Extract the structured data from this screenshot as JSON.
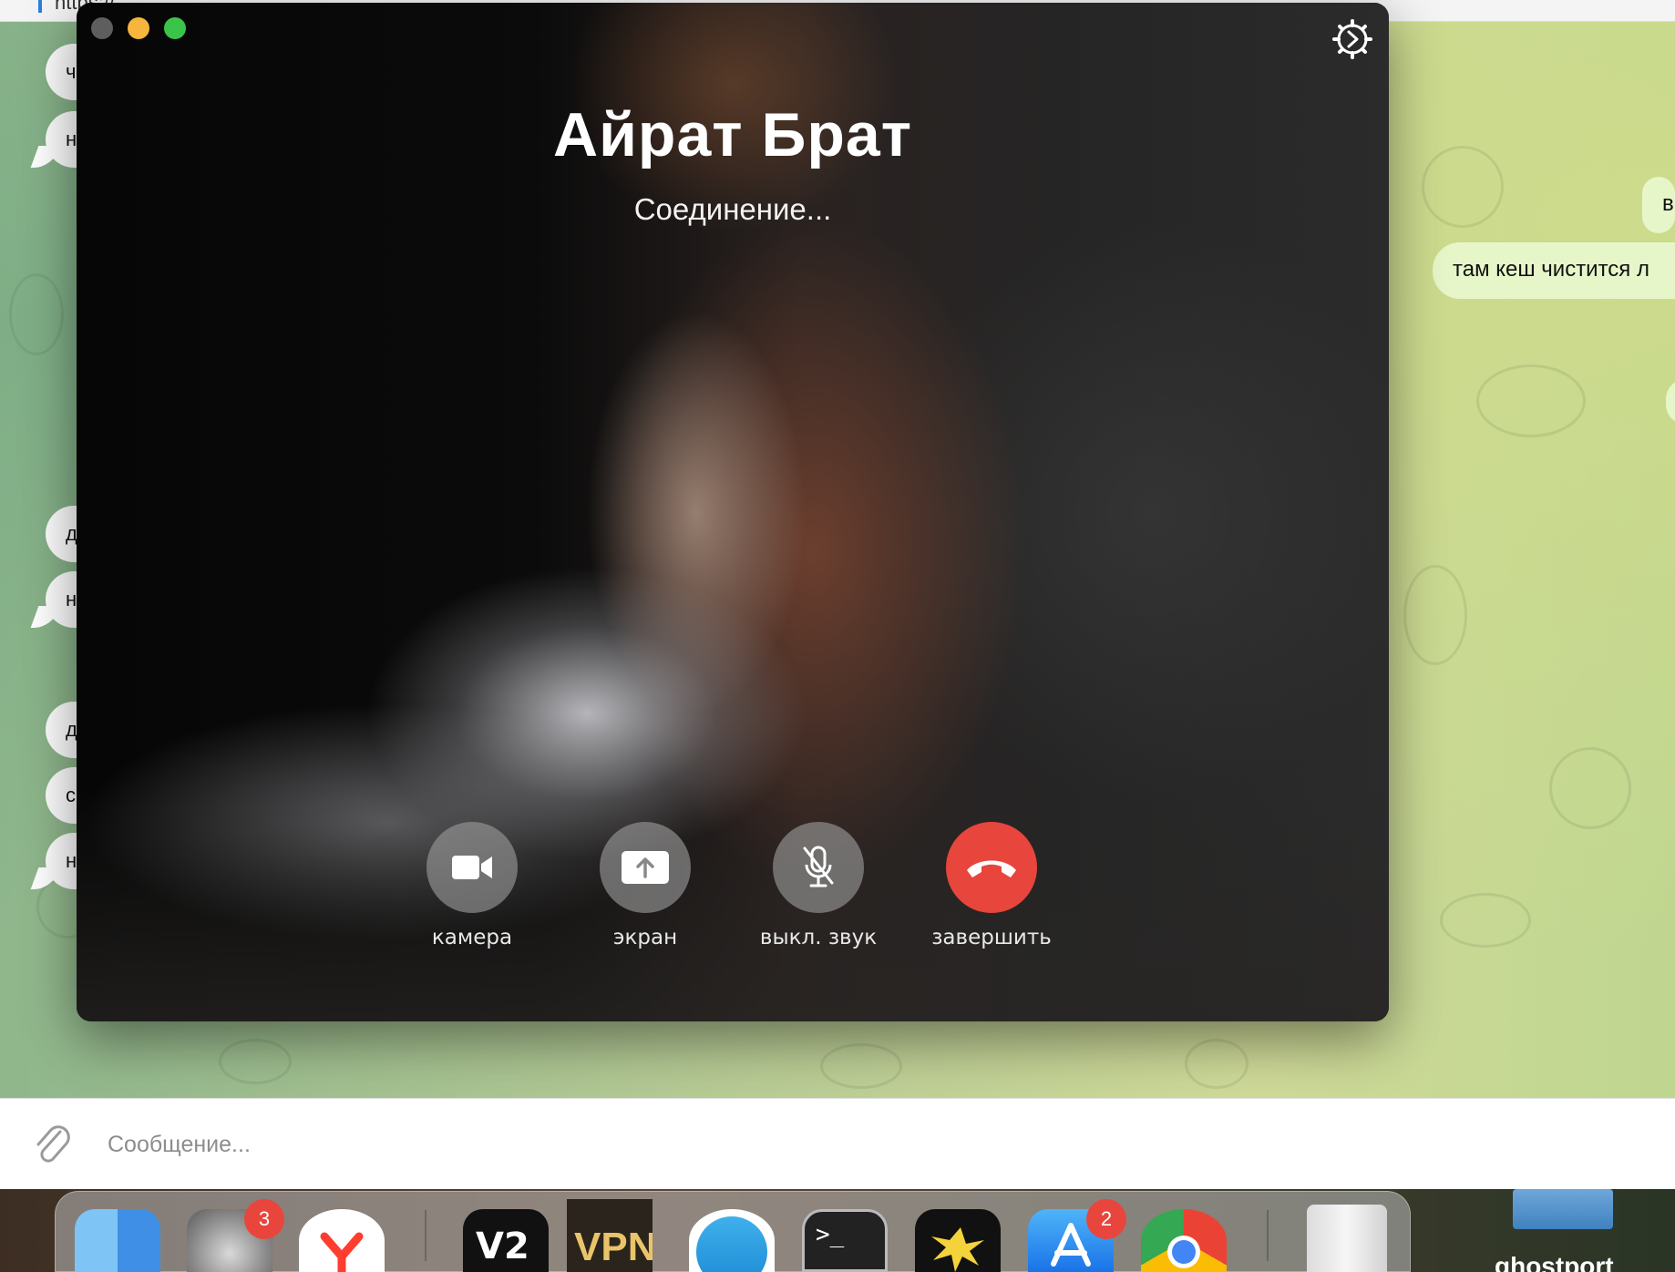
{
  "chat": {
    "top_link_text": "https://...",
    "left_bubbles": [
      "ч",
      "н",
      "д",
      "н",
      "д",
      "с",
      "н"
    ],
    "right_bubbles": [
      "в",
      "там кеш чистится л"
    ]
  },
  "call": {
    "contact_name": "Айрат Брат",
    "status": "Соединение...",
    "controls": [
      {
        "id": "camera",
        "label": "камера",
        "icon": "video-camera-icon"
      },
      {
        "id": "screen",
        "label": "экран",
        "icon": "screen-share-icon"
      },
      {
        "id": "mute",
        "label": "выкл. звук",
        "icon": "mic-off-icon"
      },
      {
        "id": "end",
        "label": "завершить",
        "icon": "hang-up-icon",
        "color": "#e8453c"
      }
    ]
  },
  "composer": {
    "placeholder": "Сообщение..."
  },
  "dock": {
    "items": [
      {
        "name": "finder",
        "badge": ""
      },
      {
        "name": "system-settings",
        "badge": "3"
      },
      {
        "name": "yandex-browser",
        "badge": ""
      },
      {
        "name": "v2box",
        "label": "V2",
        "badge": ""
      },
      {
        "name": "vpn",
        "label": "VPN",
        "badge": ""
      },
      {
        "name": "telegram",
        "badge": ""
      },
      {
        "name": "terminal",
        "label": ">_",
        "badge": ""
      },
      {
        "name": "burst-app",
        "badge": ""
      },
      {
        "name": "app-store",
        "badge": "2"
      },
      {
        "name": "chrome",
        "badge": ""
      },
      {
        "name": "trash",
        "badge": ""
      }
    ],
    "desktop_label": "ghostport"
  }
}
